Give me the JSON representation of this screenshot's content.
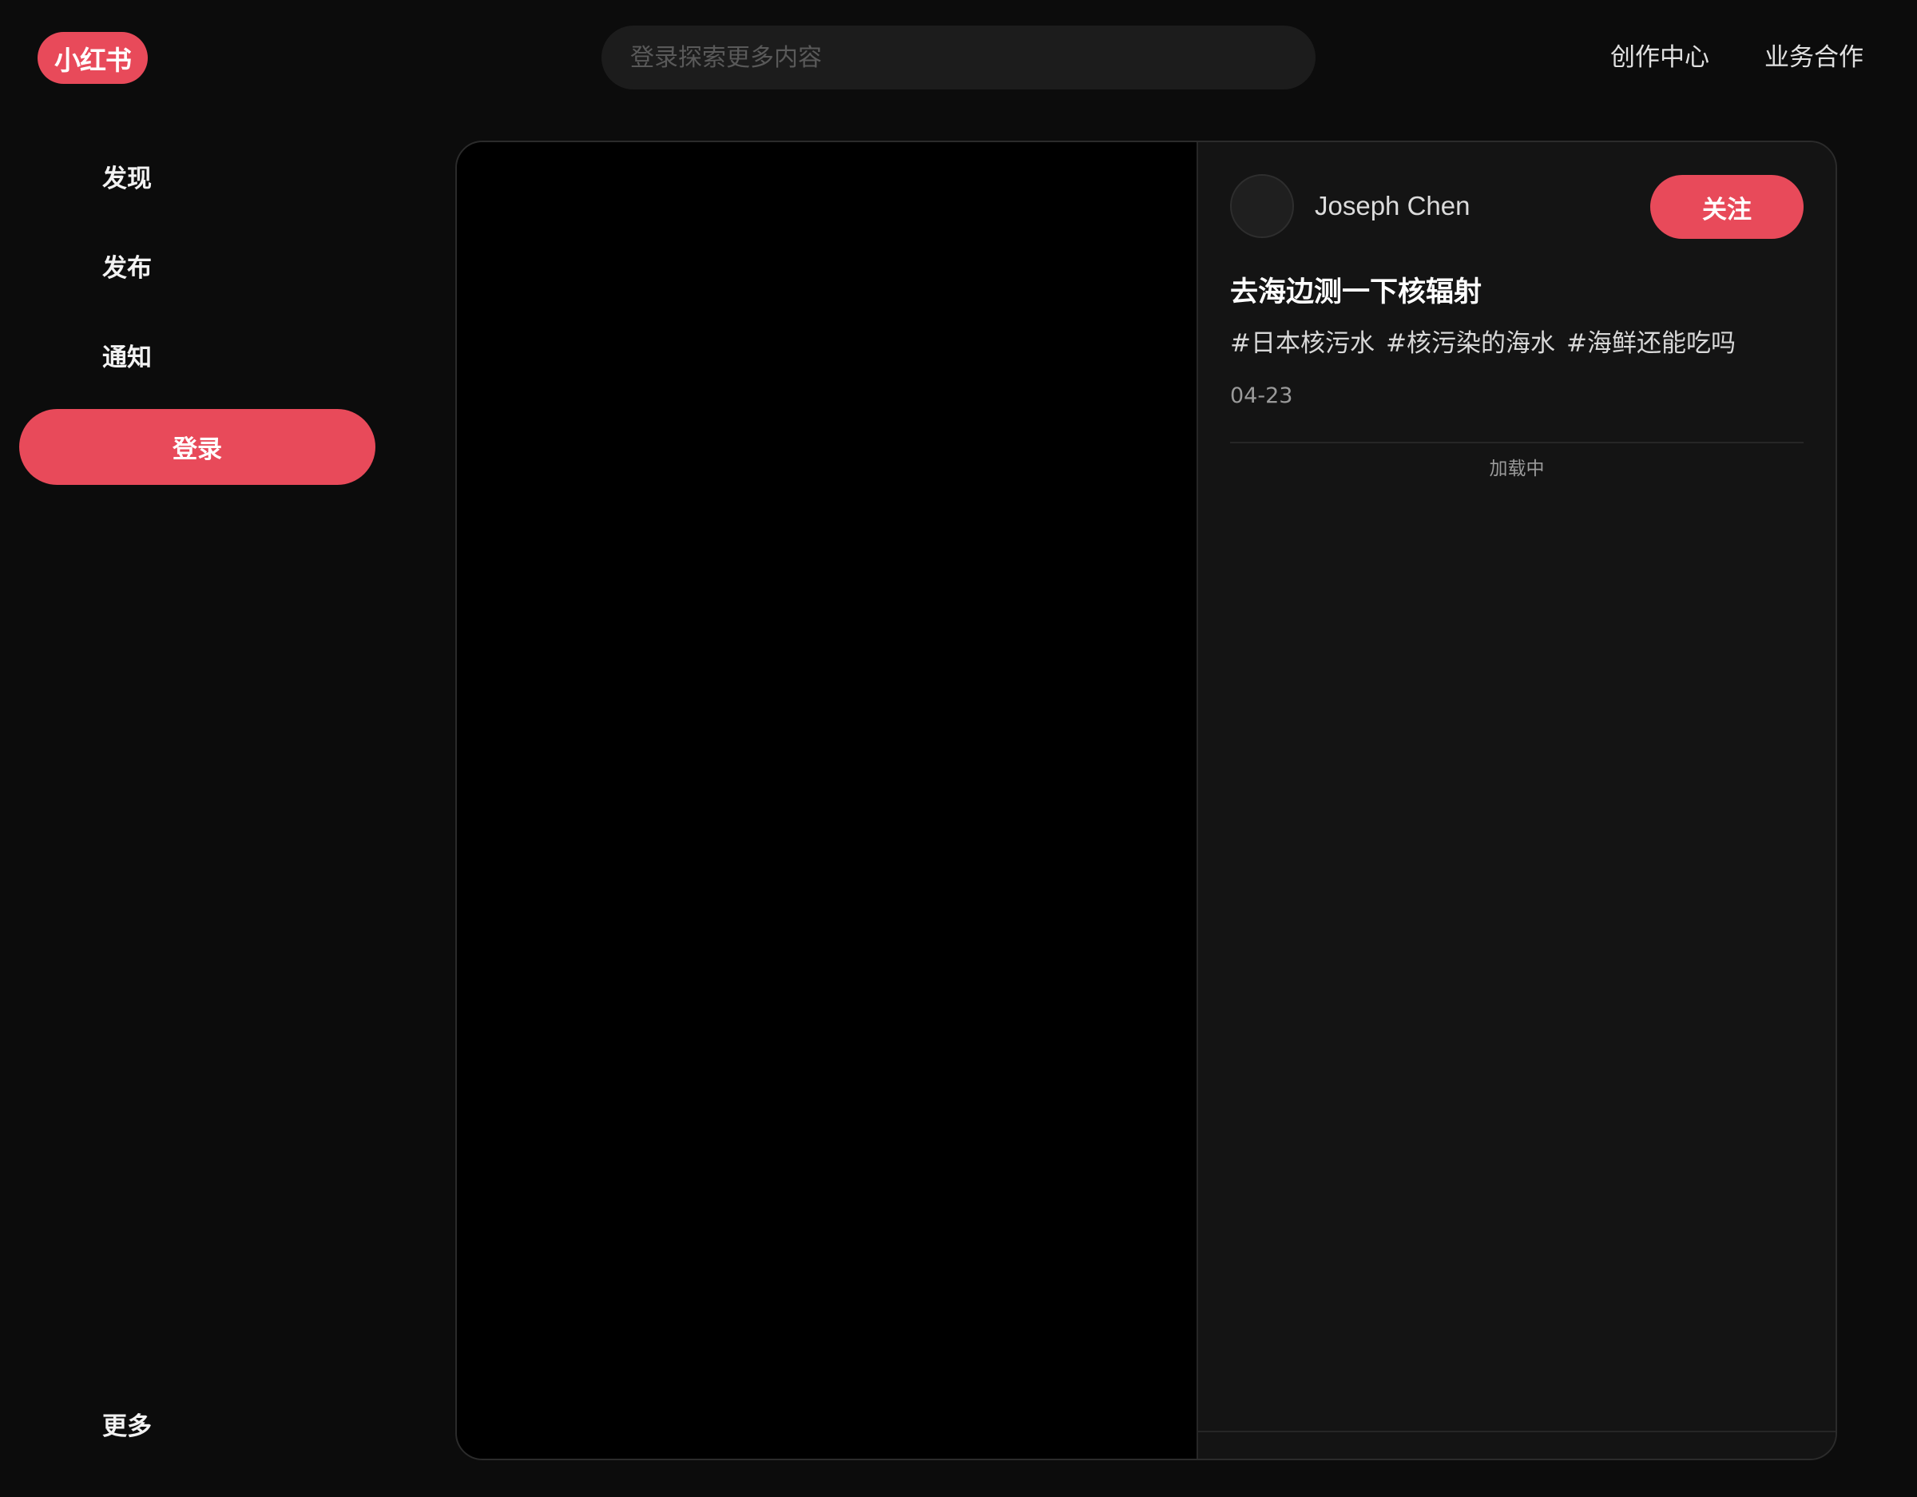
{
  "app": {
    "logo_text": "小红书",
    "brand_color": "#e84a5a"
  },
  "header": {
    "search_placeholder": "登录探索更多内容",
    "links": [
      "创作中心",
      "业务合作"
    ]
  },
  "sidebar": {
    "items": [
      {
        "label": "发现"
      },
      {
        "label": "发布"
      },
      {
        "label": "通知"
      }
    ],
    "login_label": "登录",
    "more_label": "更多"
  },
  "note": {
    "author": "Joseph Chen",
    "follow_label": "关注",
    "title": "去海边测一下核辐射",
    "tags": [
      "#日本核污水",
      "#核污染的海水",
      "#海鲜还能吃吗"
    ],
    "date": "04-23",
    "comments_status": "加载中"
  }
}
